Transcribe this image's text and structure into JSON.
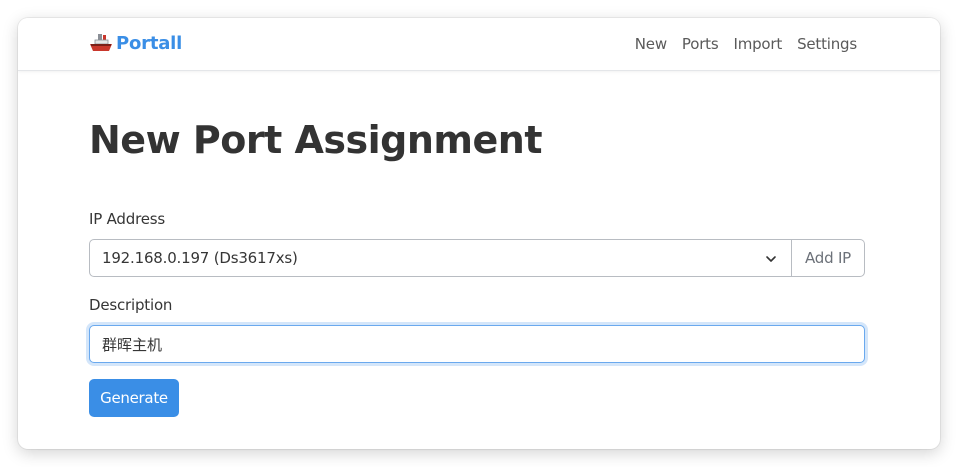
{
  "navbar": {
    "brand": "Portall",
    "brand_icon": "ship-icon",
    "links": [
      "New",
      "Ports",
      "Import",
      "Settings"
    ]
  },
  "main": {
    "title": "New Port Assignment",
    "ip_field": {
      "label": "IP Address",
      "selected": "192.168.0.197 (Ds3617xs)",
      "add_label": "Add IP"
    },
    "description_field": {
      "label": "Description",
      "value": "群晖主机"
    },
    "generate_label": "Generate"
  },
  "colors": {
    "accent": "#3a8ee6",
    "text": "#363636",
    "title": "#333333",
    "nav_text": "#5a5a5a"
  }
}
